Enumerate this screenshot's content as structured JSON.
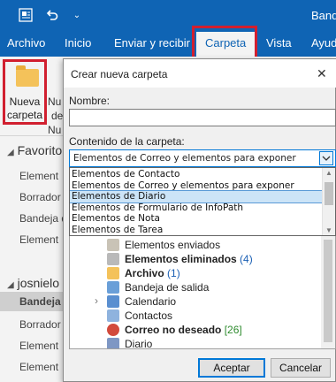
{
  "titlebar": {
    "app_title_fragment": "Band"
  },
  "ribbon_tabs": [
    "Archivo",
    "Inicio",
    "Enviar y recibir",
    "Carpeta",
    "Vista",
    "Ayud"
  ],
  "ribbon": {
    "new_folder_line1": "Nueva",
    "new_folder_line2": "carpeta",
    "frag_1": "Nu",
    "frag_2": "de",
    "frag_3": "Nu"
  },
  "nav": {
    "favorites": "Favorito",
    "favorites_items": [
      "Element",
      "Borrador",
      "Bandeja d",
      "Element"
    ],
    "account": "josnielo",
    "account_selected": "Bandeja d",
    "account_items": [
      "Borrador",
      "Element",
      "Element"
    ]
  },
  "dialog": {
    "title": "Crear nueva carpeta",
    "name_label": "Nombre:",
    "name_value": "",
    "content_label": "Contenido de la carpeta:",
    "content_selected": "Elementos de Correo y elementos para exponer",
    "content_options": [
      "Elementos de Contacto",
      "Elementos de Correo y elementos para exponer",
      "Elementos de Diario",
      "Elementos de Formulario de InfoPath",
      "Elementos de Nota",
      "Elementos de Tarea"
    ],
    "content_highlighted_index": 2,
    "tree": [
      {
        "label": "Elementos enviados",
        "count": "",
        "bold": false
      },
      {
        "label": "Elementos eliminados",
        "count": "(4)",
        "bold": true
      },
      {
        "label": "Archivo",
        "count": "(1)",
        "bold": true
      },
      {
        "label": "Bandeja de salida",
        "count": "",
        "bold": false
      },
      {
        "label": "Calendario",
        "count": "",
        "bold": false
      },
      {
        "label": "Contactos",
        "count": "",
        "bold": false
      },
      {
        "label": "Correo no deseado",
        "count": "[26]",
        "bold": true
      },
      {
        "label": "Diario",
        "count": "",
        "bold": false
      }
    ],
    "ok_label": "Aceptar",
    "cancel_label": "Cancelar"
  },
  "colors": {
    "accent": "#0f64b4",
    "highlight_outline": "#d11f2f"
  }
}
